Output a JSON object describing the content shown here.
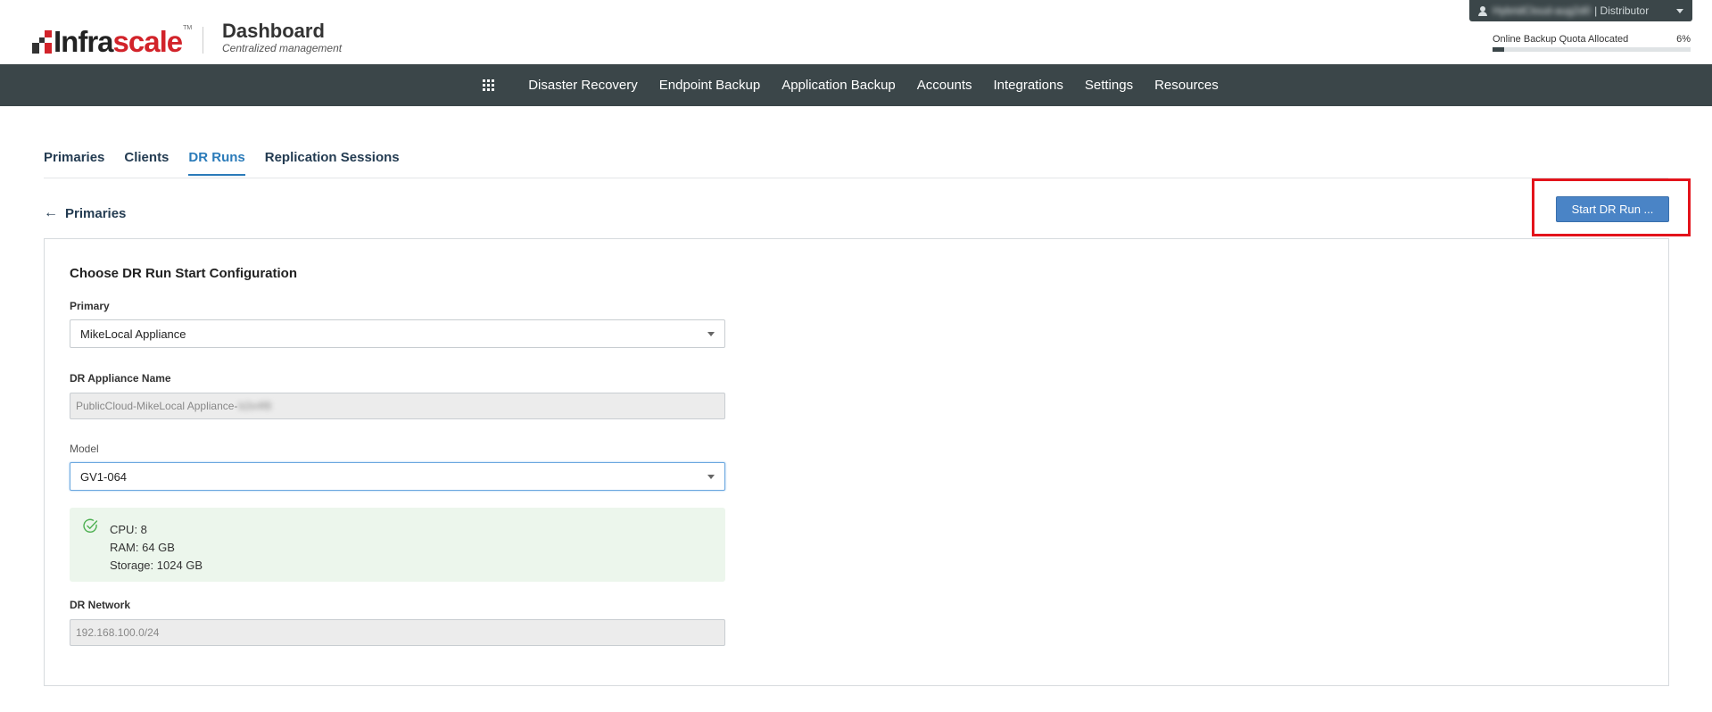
{
  "header": {
    "logo_text_a": "Infra",
    "logo_text_b": "scale",
    "logo_tm": "TM",
    "title": "Dashboard",
    "subtitle": "Centralized management",
    "user": {
      "name": "HybridCloud-aug2d0",
      "role": "| Distributor"
    },
    "quota": {
      "label": "Online Backup Quota Allocated",
      "percent_text": "6%",
      "percent_value": 6
    }
  },
  "nav": {
    "items": [
      "Disaster Recovery",
      "Endpoint Backup",
      "Application Backup",
      "Accounts",
      "Integrations",
      "Settings",
      "Resources"
    ]
  },
  "tabs": [
    "Primaries",
    "Clients",
    "DR Runs",
    "Replication Sessions"
  ],
  "active_tab": "DR Runs",
  "back_link": "Primaries",
  "start_button": "Start DR Run ...",
  "form": {
    "title": "Choose DR Run Start Configuration",
    "primary_label": "Primary",
    "primary_value": "MikeLocal Appliance",
    "appliance_label": "DR Appliance Name",
    "appliance_value": "PublicCloud-MikeLocal Appliance-",
    "appliance_suffix": "b2e4f8",
    "model_label": "Model",
    "model_value": "GV1-064",
    "specs": {
      "cpu": "CPU: 8",
      "ram": "RAM: 64 GB",
      "storage": "Storage: 1024 GB"
    },
    "network_label": "DR Network",
    "network_value": "192.168.100.0/24"
  },
  "colors": {
    "nav_bg": "#3b4649",
    "accent": "#2b7bb9",
    "button": "#4a84c6",
    "highlight": "#e3131b",
    "success_bg": "#ecf6ec",
    "success_icon": "#4caf50"
  }
}
